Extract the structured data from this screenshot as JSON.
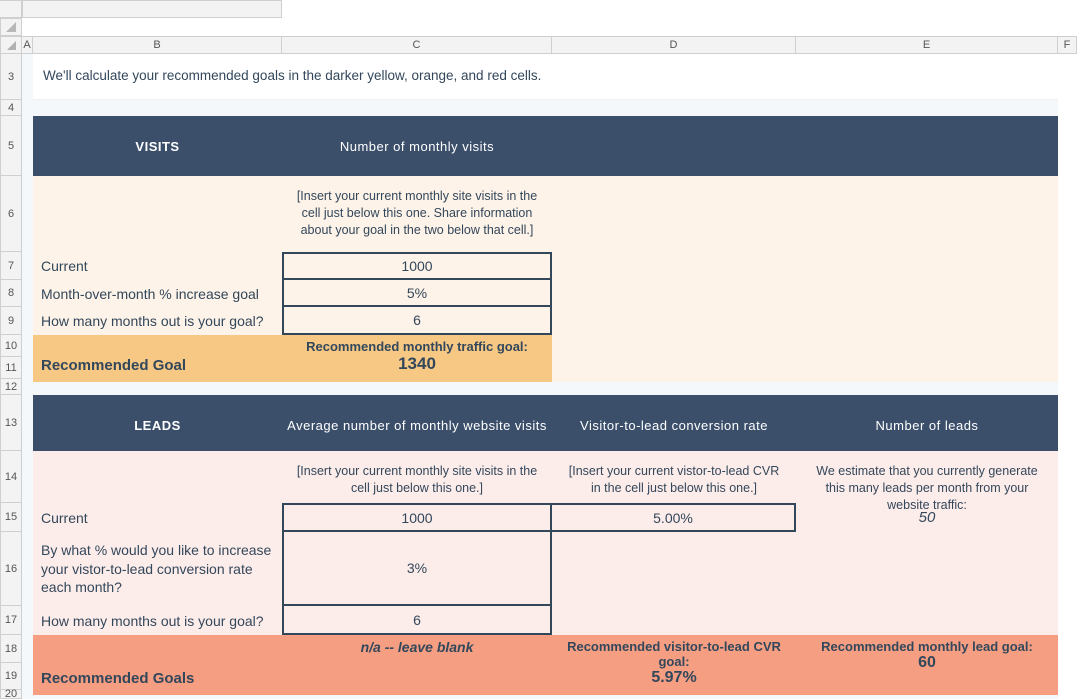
{
  "columns": [
    "A",
    "B",
    "C",
    "D",
    "E",
    "F"
  ],
  "row_numbers": [
    "3",
    "4",
    "5",
    "6",
    "7",
    "8",
    "9",
    "10",
    "11",
    "12",
    "13",
    "14",
    "15",
    "16",
    "17",
    "18",
    "19",
    "20"
  ],
  "instruction": "We'll calculate your recommended goals in the darker yellow, orange, and red cells.",
  "visits": {
    "title": "VISITS",
    "col_c": "Number of monthly visits",
    "hint_c": "[Insert your current monthly site visits in the cell just below this one. Share information about your goal in the two below that cell.]",
    "rows": {
      "current_label": "Current",
      "current_value": "1000",
      "mom_label": "Month-over-month % increase goal",
      "mom_value": "5%",
      "months_label": "How many months out is your goal?",
      "months_value": "6"
    },
    "recommended": {
      "label": "Recommended Goal",
      "caption": "Recommended monthly traffic goal:",
      "value": "1340"
    }
  },
  "leads": {
    "title": "LEADS",
    "col_c": "Average number of monthly website visits",
    "col_d": "Visitor-to-lead conversion rate",
    "col_e": "Number of leads",
    "hint_c": "[Insert your current monthly site visits in the cell just below this one.]",
    "hint_d": "[Insert your current vistor-to-lead CVR in the cell just below this one.]",
    "hint_e": "We estimate that you currently generate this many leads per month from your website traffic:",
    "rows": {
      "current_label": "Current",
      "current_visits": "1000",
      "current_cvr": "5.00%",
      "current_leads": "50",
      "pct_label": "By what % would you like to increase your vistor-to-lead conversion rate each month?",
      "pct_value": "3%",
      "months_label": "How many months out is your goal?",
      "months_value": "6"
    },
    "recommended": {
      "label": "Recommended Goals",
      "blank_caption": "",
      "blank_value": "n/a -- leave blank",
      "cvr_caption": "Recommended visitor-to-lead CVR goal:",
      "cvr_value": "5.97%",
      "leads_caption": "Recommended monthly lead goal:",
      "leads_value": "60"
    }
  }
}
